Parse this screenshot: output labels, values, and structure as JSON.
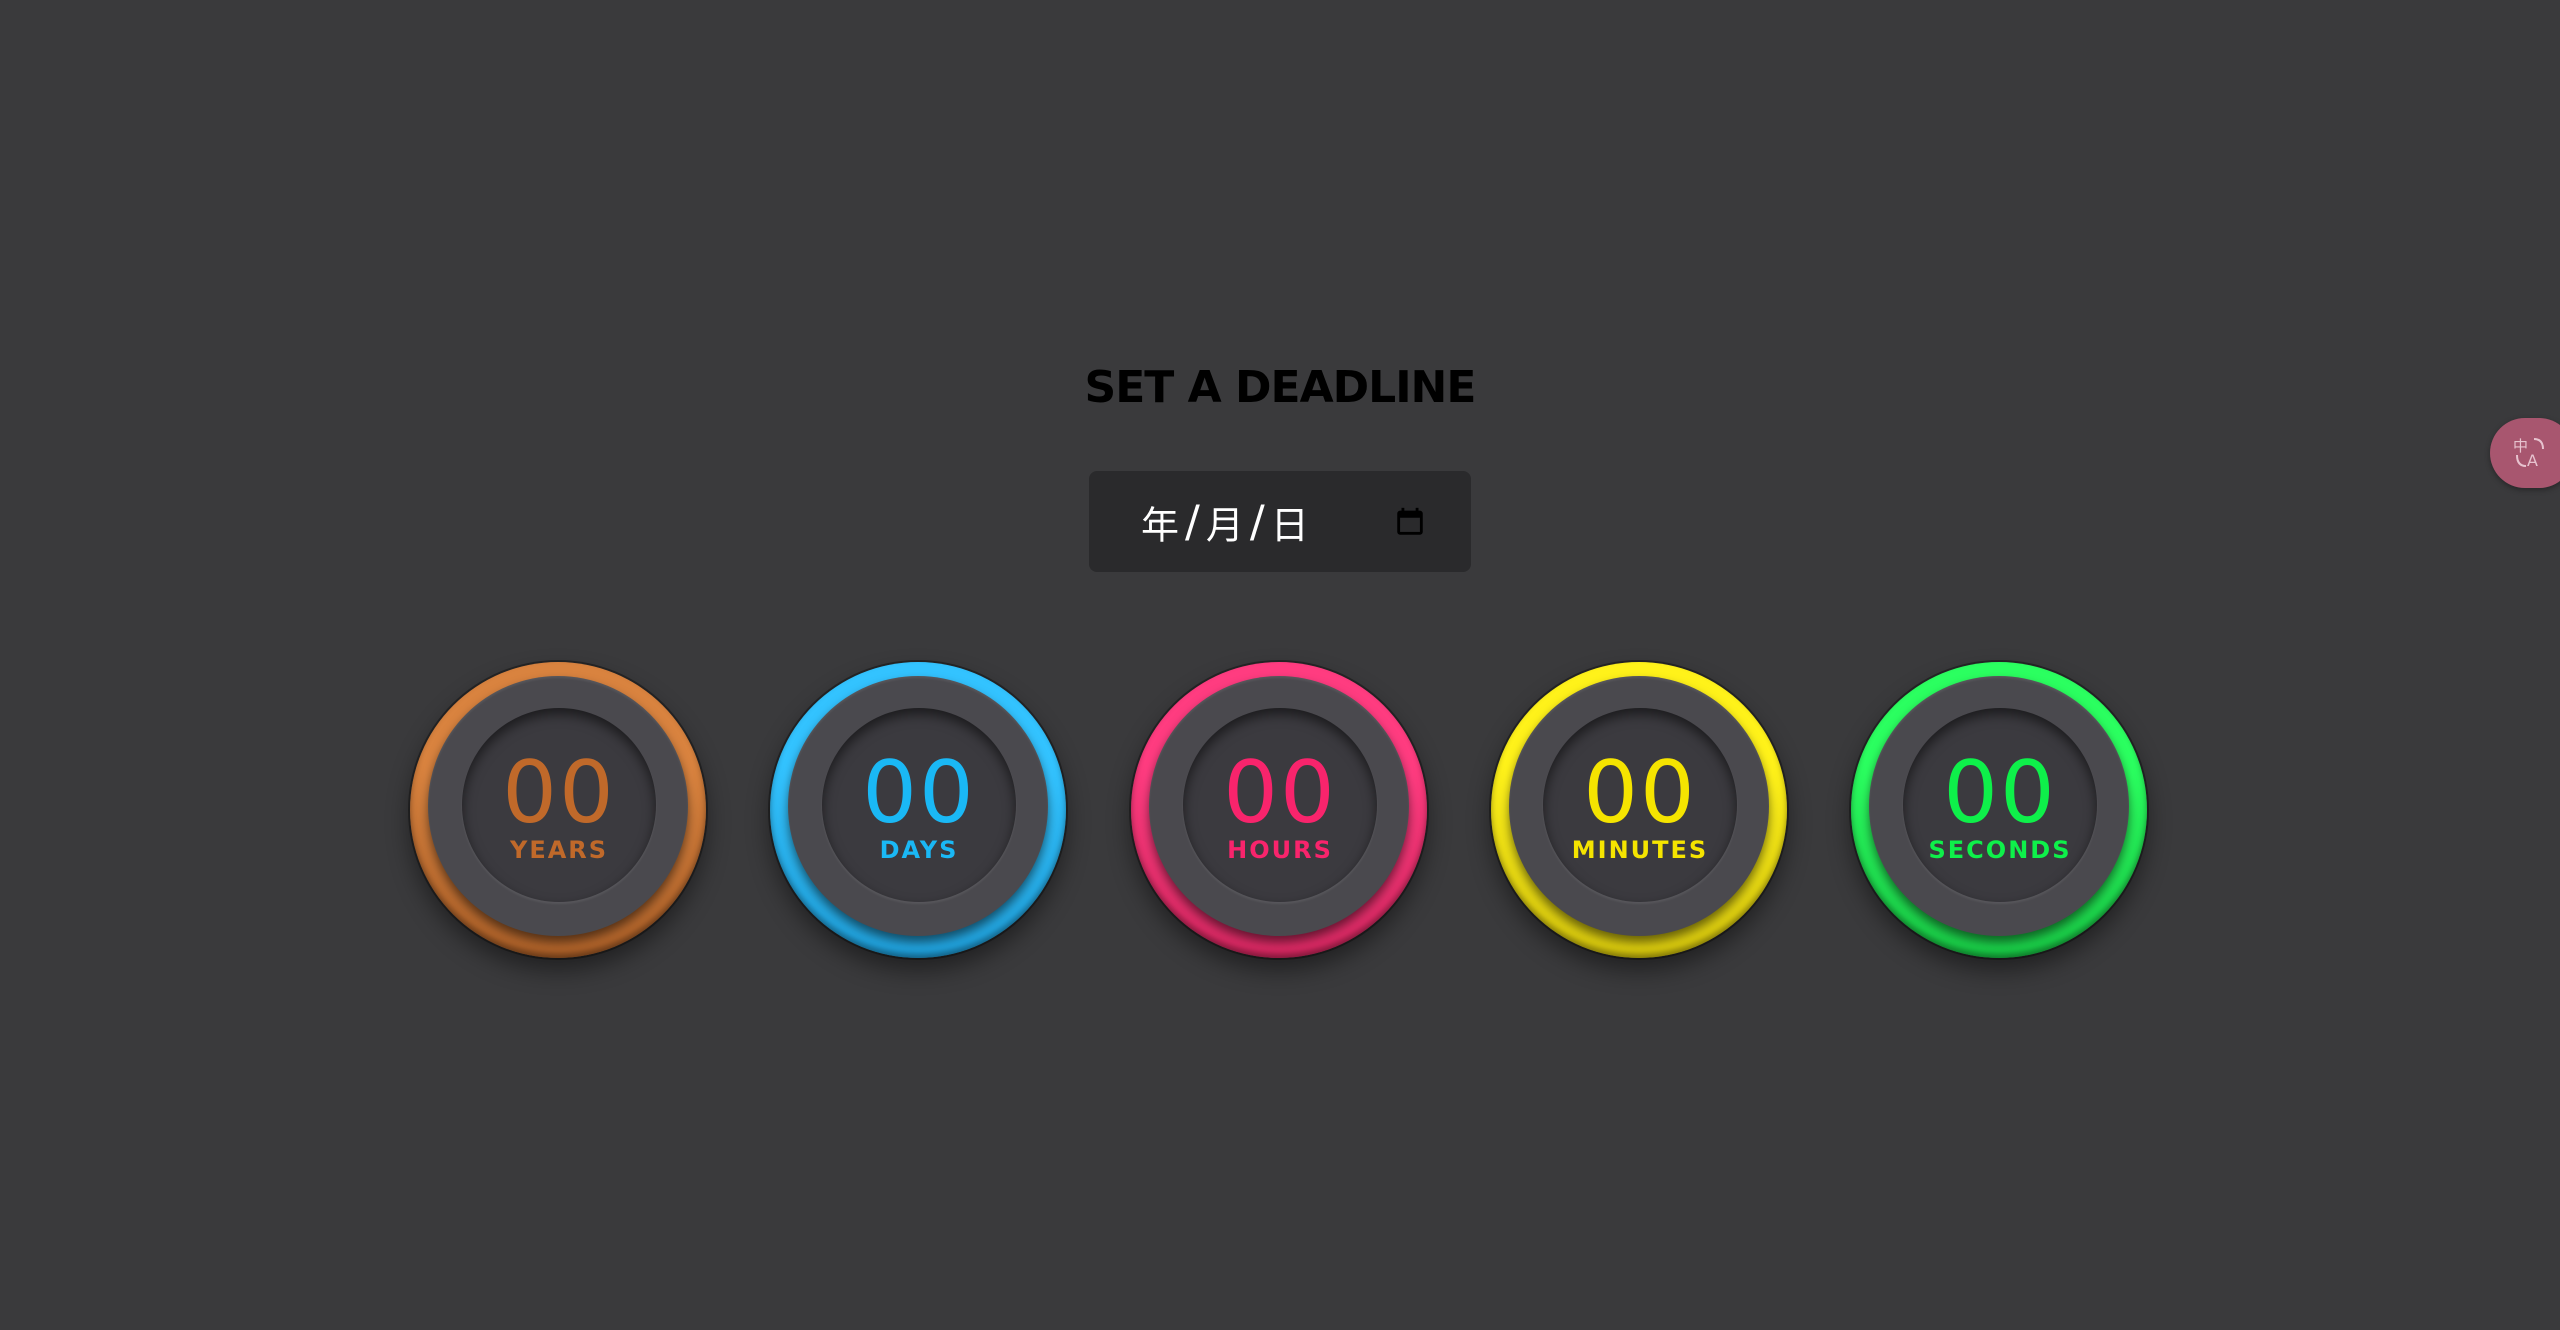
{
  "heading": "SET A DEADLINE",
  "date_input": {
    "year": "年",
    "month": "月",
    "day": "日",
    "separator": "/",
    "icon": "calendar-icon"
  },
  "dials": [
    {
      "value": "00",
      "label": "YEARS",
      "color": "#c0692a",
      "ring_light": "#d9833f",
      "ring_dark": "#7a3a10"
    },
    {
      "value": "00",
      "label": "DAYS",
      "color": "#1ab8f5",
      "ring_light": "#33c3ff",
      "ring_dark": "#0b78b0"
    },
    {
      "value": "00",
      "label": "HOURS",
      "color": "#f8246c",
      "ring_light": "#ff3c80",
      "ring_dark": "#a8123f"
    },
    {
      "value": "00",
      "label": "MINUTES",
      "color": "#f5e400",
      "ring_light": "#fff21a",
      "ring_dark": "#a89600"
    },
    {
      "value": "00",
      "label": "SECONDS",
      "color": "#0ef04a",
      "ring_light": "#2bff60",
      "ring_dark": "#06902a"
    }
  ],
  "translate_button": {
    "icon": "translate-icon",
    "color": "#a8566f"
  }
}
